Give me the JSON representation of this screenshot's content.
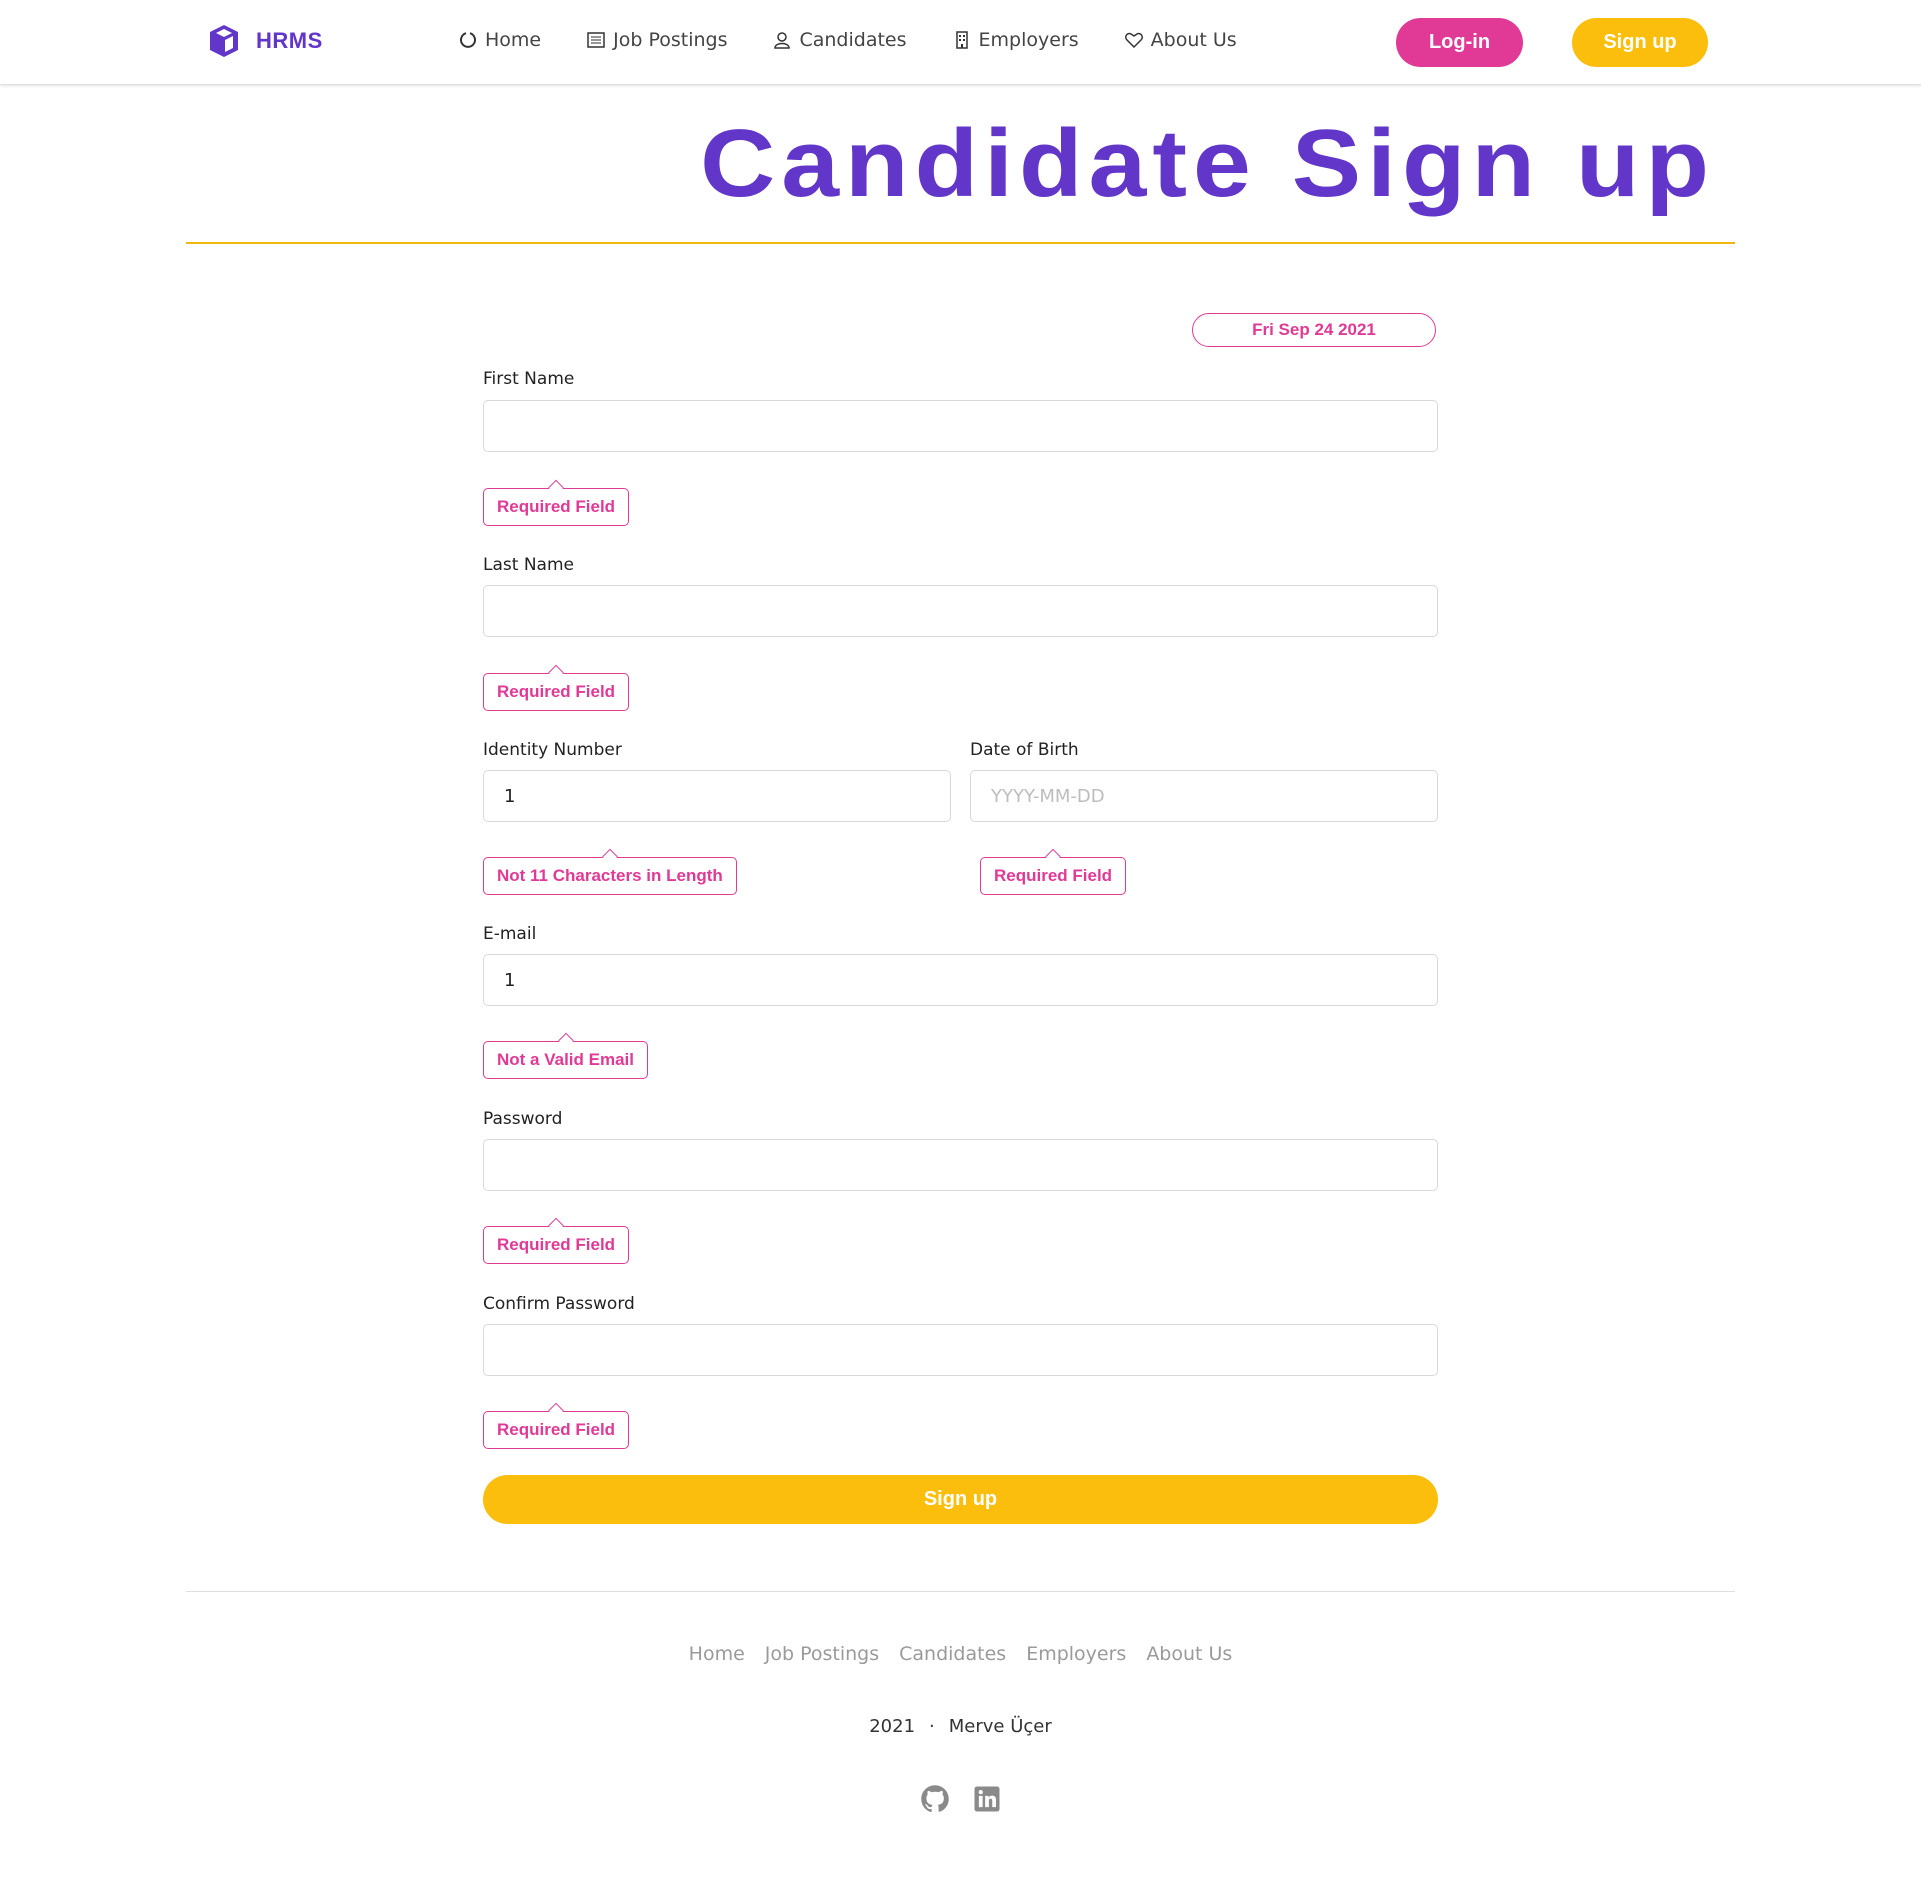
{
  "header": {
    "brand": "HRMS",
    "nav": [
      {
        "label": "Home",
        "icon": "circle-notch-icon"
      },
      {
        "label": "Job Postings",
        "icon": "list-icon"
      },
      {
        "label": "Candidates",
        "icon": "user-icon"
      },
      {
        "label": "Employers",
        "icon": "building-icon"
      },
      {
        "label": "About Us",
        "icon": "heart-icon"
      }
    ],
    "login_label": "Log-in",
    "signup_label": "Sign up"
  },
  "page": {
    "title": "Candidate Sign up",
    "date": "Fri Sep 24 2021"
  },
  "form": {
    "first_name": {
      "label": "First Name",
      "value": "",
      "error": "Required Field"
    },
    "last_name": {
      "label": "Last Name",
      "value": "",
      "error": "Required Field"
    },
    "identity_number": {
      "label": "Identity Number",
      "value": "1",
      "error": "Not 11 Characters in Length"
    },
    "date_of_birth": {
      "label": "Date of Birth",
      "value": "",
      "placeholder": "YYYY-MM-DD",
      "error": "Required Field"
    },
    "email": {
      "label": "E-mail",
      "value": "1",
      "error": "Not a Valid Email"
    },
    "password": {
      "label": "Password",
      "value": "",
      "error": "Required Field"
    },
    "confirm_password": {
      "label": "Confirm Password",
      "value": "",
      "error": "Required Field"
    },
    "submit_label": "Sign up"
  },
  "footer": {
    "links": [
      "Home",
      "Job Postings",
      "Candidates",
      "Employers",
      "About Us"
    ],
    "year": "2021",
    "separator": "·",
    "author": "Merve Üçer",
    "social": [
      "github-icon",
      "linkedin-icon"
    ]
  },
  "colors": {
    "brand_purple": "#6236c9",
    "accent_pink": "#e03a96",
    "accent_yellow": "#fbbe0c"
  }
}
